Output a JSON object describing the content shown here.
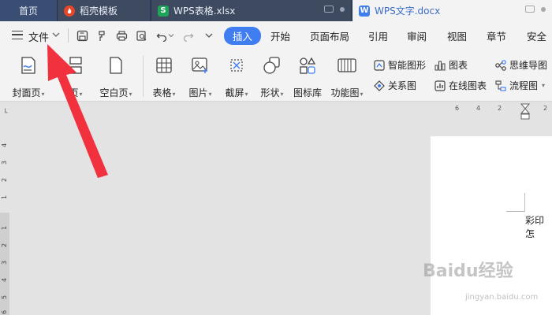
{
  "tabs": [
    {
      "label": "首页"
    },
    {
      "label": "稻壳模板",
      "icon": "daoke-flame-icon",
      "color": "#e6472a"
    },
    {
      "label": "WPS表格.xlsx",
      "icon": "spreadsheet-icon",
      "color": "#1fa25a"
    },
    {
      "label": "WPS文字.docx",
      "icon": "writer-icon",
      "color": "#3f7df1"
    }
  ],
  "menu": {
    "file_label": "文件",
    "tabs": [
      "插入",
      "开始",
      "页面布局",
      "引用",
      "审阅",
      "视图",
      "章节",
      "安全"
    ],
    "active_tab": "插入"
  },
  "ribbon": {
    "big": [
      "封面页",
      "页",
      "空白页",
      "表格",
      "图片",
      "截屏",
      "形状",
      "图标库",
      "功能图"
    ],
    "small": [
      "智能图形",
      "图表",
      "思维导图",
      "关系图",
      "在线图表",
      "流程图"
    ]
  },
  "ruler": {
    "top_numbers": [
      "6",
      "4",
      "2",
      "2"
    ],
    "left_numbers": [
      "4",
      "3",
      "2",
      "1",
      "1",
      "2",
      "3",
      "4",
      "5",
      "6"
    ]
  },
  "document": {
    "visible_text": "彩印怎"
  },
  "watermark": {
    "main": "Baidu经验",
    "sub": "jingyan.baidu.com"
  },
  "colors": {
    "accent": "#3f7df1",
    "tabbar": "#2f3f5f",
    "arrow": "#f2313f"
  }
}
